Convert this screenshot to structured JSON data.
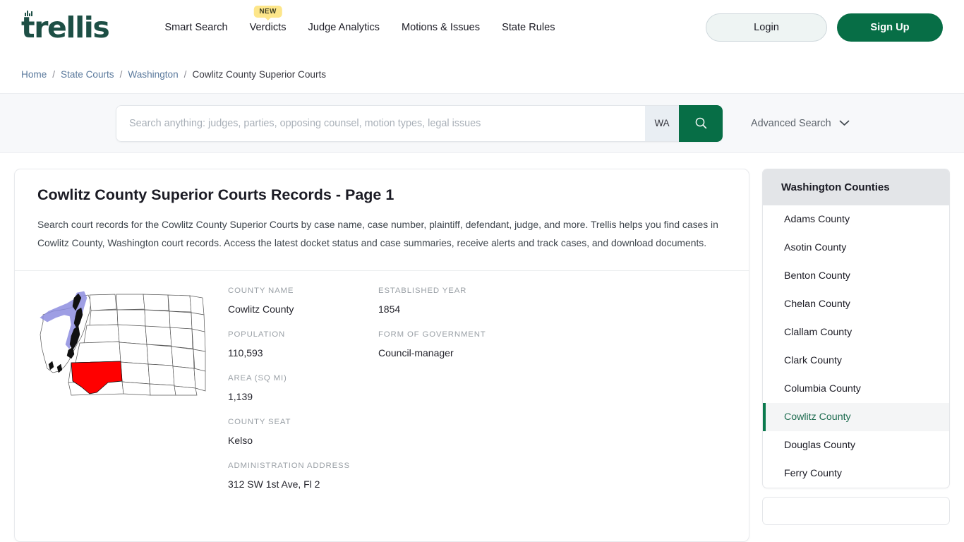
{
  "brand": {
    "name": "trellis",
    "logo_icon": "trellis-bars-icon"
  },
  "nav": {
    "items": [
      {
        "label": "Smart Search",
        "badge": null
      },
      {
        "label": "Verdicts",
        "badge": "NEW"
      },
      {
        "label": "Judge Analytics",
        "badge": null
      },
      {
        "label": "Motions & Issues",
        "badge": null
      },
      {
        "label": "State Rules",
        "badge": null
      }
    ]
  },
  "auth": {
    "login_label": "Login",
    "signup_label": "Sign Up"
  },
  "breadcrumb": {
    "items": [
      {
        "label": "Home",
        "current": false
      },
      {
        "label": "State Courts",
        "current": false
      },
      {
        "label": "Washington",
        "current": false
      },
      {
        "label": "Cowlitz County Superior Courts",
        "current": true
      }
    ],
    "separator": "/"
  },
  "search": {
    "placeholder": "Search anything: judges, parties, opposing counsel, motion types, legal issues",
    "value": "",
    "state_chip": "WA",
    "search_icon": "magnifier-icon",
    "advanced_label": "Advanced Search",
    "advanced_icon": "chevron-down-icon"
  },
  "main": {
    "title": "Cowlitz County Superior Courts Records - Page 1",
    "description": "Search court records for the Cowlitz County Superior Courts by case name, case number, plaintiff, defendant, judge, and more. Trellis helps you find cases in Cowlitz County, Washington court records. Access the latest docket status and case summaries, receive alerts and track cases, and download documents.",
    "map_alt": "washington-county-map-icon",
    "fields_col1": [
      {
        "label": "COUNTY NAME",
        "value": "Cowlitz County"
      },
      {
        "label": "POPULATION",
        "value": "110,593"
      },
      {
        "label": "AREA (SQ MI)",
        "value": "1,139"
      },
      {
        "label": "COUNTY SEAT",
        "value": "Kelso"
      },
      {
        "label": "ADMINISTRATION ADDRESS",
        "value": "312 SW 1st Ave, Fl 2"
      }
    ],
    "fields_col2": [
      {
        "label": "ESTABLISHED YEAR",
        "value": "1854"
      },
      {
        "label": "FORM OF GOVERNMENT",
        "value": "Council-manager"
      }
    ]
  },
  "sidebar": {
    "title": "Washington Counties",
    "items": [
      {
        "label": "Adams County",
        "active": false
      },
      {
        "label": "Asotin County",
        "active": false
      },
      {
        "label": "Benton County",
        "active": false
      },
      {
        "label": "Chelan County",
        "active": false
      },
      {
        "label": "Clallam County",
        "active": false
      },
      {
        "label": "Clark County",
        "active": false
      },
      {
        "label": "Columbia County",
        "active": false
      },
      {
        "label": "Cowlitz County",
        "active": true
      },
      {
        "label": "Douglas County",
        "active": false
      },
      {
        "label": "Ferry County",
        "active": false
      }
    ]
  },
  "colors": {
    "brand_green": "#1d4f45",
    "accent_green": "#076e46",
    "active_green": "#0b7a4e",
    "badge_yellow": "#fde68a",
    "link_blue": "#5b7a9d",
    "map_highlight": "#ff0000",
    "map_water": "#8e8ee0"
  }
}
